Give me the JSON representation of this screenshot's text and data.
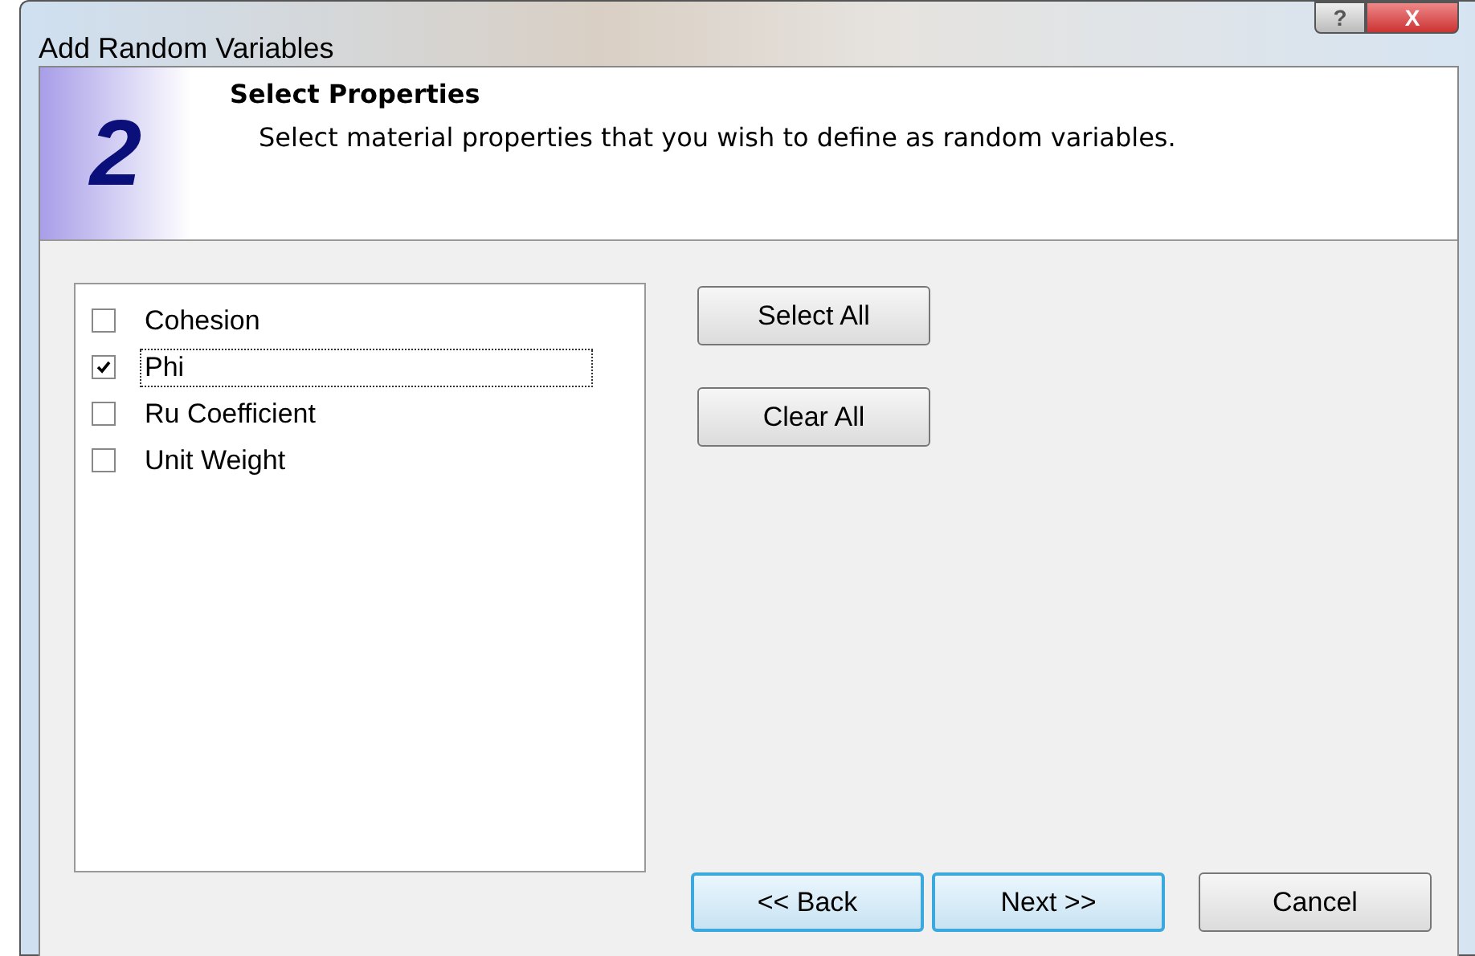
{
  "window": {
    "title": "Add Random Variables",
    "help_button": "?",
    "close_button": "X"
  },
  "header": {
    "step": "2",
    "title": "Select Properties",
    "description": "Select material properties that you wish to define as random variables."
  },
  "properties": [
    {
      "label": "Cohesion",
      "checked": false,
      "focused": false
    },
    {
      "label": "Phi",
      "checked": true,
      "focused": true
    },
    {
      "label": "Ru Coefficient",
      "checked": false,
      "focused": false
    },
    {
      "label": "Unit Weight",
      "checked": false,
      "focused": false
    }
  ],
  "side_buttons": [
    "Select All",
    "Clear All"
  ],
  "footer_buttons": [
    {
      "label": "<< Back",
      "kind": "nav"
    },
    {
      "label": "Next >>",
      "kind": "nav"
    },
    {
      "label": "Cancel",
      "kind": "plain"
    }
  ]
}
